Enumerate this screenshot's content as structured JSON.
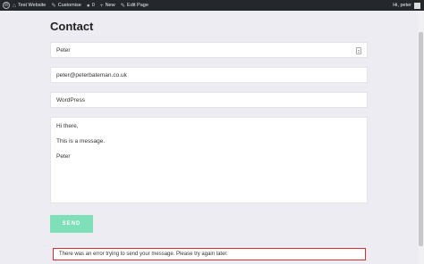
{
  "adminbar": {
    "site_name": "Test Website",
    "customise": "Customise",
    "comments_count": "0",
    "new": "New",
    "edit_page": "Edit Page",
    "greeting": "Hi, peter"
  },
  "page": {
    "title": "Contact"
  },
  "form": {
    "name_value": "Peter",
    "email_value": "peter@peterbateman.co.uk",
    "subject_value": "WordPress",
    "message_lines": [
      "Hi there,",
      "This is a message.",
      "Peter"
    ],
    "send_label": "SEND"
  },
  "error": {
    "text": "There was an error trying to send your message. Please try again later.",
    "border_color": "#e02b2b"
  },
  "colors": {
    "adminbar_bg": "#23282d",
    "send_button_bg": "#7ee0b8",
    "page_bg": "#ececf2"
  },
  "icons": [
    "wordpress-icon",
    "home-icon",
    "brush-icon",
    "comment-icon",
    "plus-icon",
    "pencil-icon",
    "key-icon"
  ]
}
